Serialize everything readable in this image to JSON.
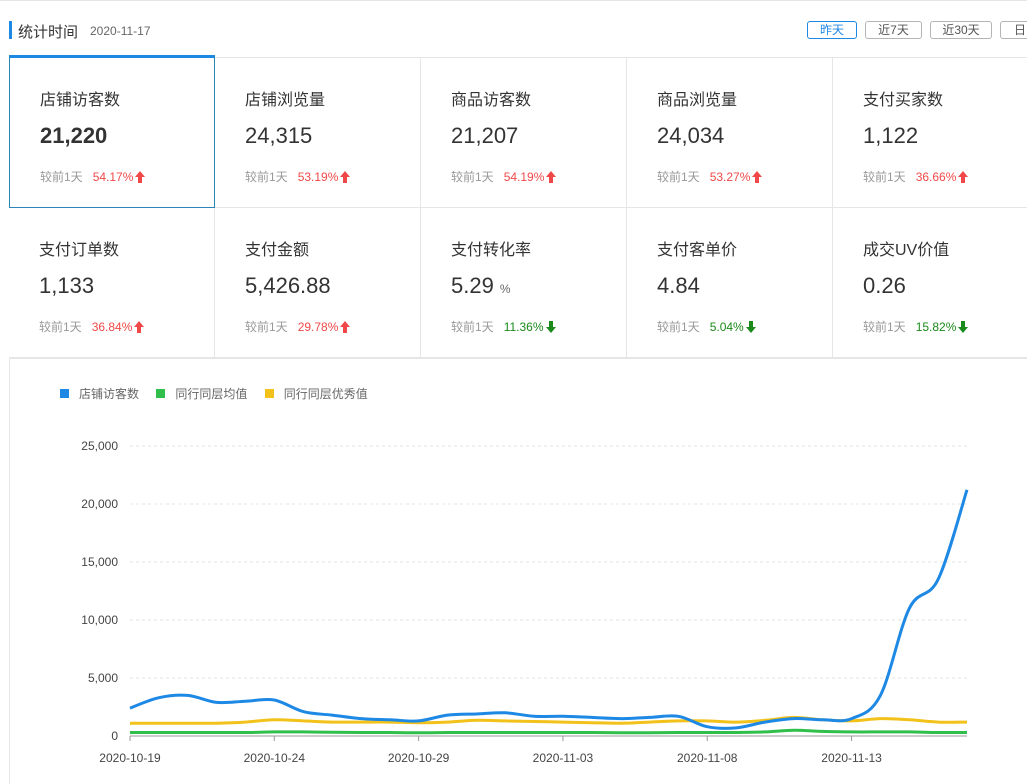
{
  "header": {
    "title": "统计时间",
    "date": "2020-11-17",
    "ranges": [
      "昨天",
      "近7天",
      "近30天",
      "日"
    ],
    "active_range": "昨天"
  },
  "colors": {
    "accent": "#1e88e5",
    "up": "#f04848",
    "down": "#1a8a1a",
    "series": [
      "#1e88e5",
      "#2fbf4a",
      "#f2c21b"
    ]
  },
  "metrics": [
    {
      "label": "店铺访客数",
      "value": "21,220",
      "compare": "较前1天",
      "pct": "54.17%",
      "dir": "up"
    },
    {
      "label": "店铺浏览量",
      "value": "24,315",
      "compare": "较前1天",
      "pct": "53.19%",
      "dir": "up"
    },
    {
      "label": "商品访客数",
      "value": "21,207",
      "compare": "较前1天",
      "pct": "54.19%",
      "dir": "up"
    },
    {
      "label": "商品浏览量",
      "value": "24,034",
      "compare": "较前1天",
      "pct": "53.27%",
      "dir": "up"
    },
    {
      "label": "支付买家数",
      "value": "1,122",
      "compare": "较前1天",
      "pct": "36.66%",
      "dir": "up"
    },
    {
      "label": "支付订单数",
      "value": "1,133",
      "compare": "较前1天",
      "pct": "36.84%",
      "dir": "up"
    },
    {
      "label": "支付金额",
      "value": "5,426.88",
      "compare": "较前1天",
      "pct": "29.78%",
      "dir": "up"
    },
    {
      "label": "支付转化率",
      "value": "5.29",
      "unit": "%",
      "compare": "较前1天",
      "pct": "11.36%",
      "dir": "down"
    },
    {
      "label": "支付客单价",
      "value": "4.84",
      "compare": "较前1天",
      "pct": "5.04%",
      "dir": "down"
    },
    {
      "label": "成交UV价值",
      "value": "0.26",
      "compare": "较前1天",
      "pct": "15.82%",
      "dir": "down"
    }
  ],
  "chart_data": {
    "type": "line",
    "title": "",
    "xlabel": "",
    "ylabel": "",
    "ylim": [
      0,
      25000
    ],
    "yticks": [
      0,
      5000,
      10000,
      15000,
      20000,
      25000
    ],
    "ytick_labels": [
      "0",
      "5,000",
      "10,000",
      "15,000",
      "20,000",
      "25,000"
    ],
    "xtick_labels": [
      "2020-10-19",
      "2020-10-24",
      "2020-10-29",
      "2020-11-03",
      "2020-11-08",
      "2020-11-13"
    ],
    "grid": true,
    "legend_position": "top-left",
    "x": [
      "2020-10-19",
      "2020-10-20",
      "2020-10-21",
      "2020-10-22",
      "2020-10-23",
      "2020-10-24",
      "2020-10-25",
      "2020-10-26",
      "2020-10-27",
      "2020-10-28",
      "2020-10-29",
      "2020-10-30",
      "2020-10-31",
      "2020-11-01",
      "2020-11-02",
      "2020-11-03",
      "2020-11-04",
      "2020-11-05",
      "2020-11-06",
      "2020-11-07",
      "2020-11-08",
      "2020-11-09",
      "2020-11-10",
      "2020-11-11",
      "2020-11-12",
      "2020-11-13",
      "2020-11-14",
      "2020-11-15",
      "2020-11-16",
      "2020-11-17"
    ],
    "series": [
      {
        "name": "店铺访客数",
        "values": [
          2400,
          3300,
          3500,
          2900,
          3000,
          3100,
          2100,
          1800,
          1500,
          1400,
          1300,
          1800,
          1900,
          2000,
          1700,
          1700,
          1600,
          1500,
          1600,
          1700,
          800,
          700,
          1200,
          1500,
          1400,
          1500,
          3500,
          11000,
          13500,
          21220
        ]
      },
      {
        "name": "同行同层均值",
        "values": [
          300,
          300,
          300,
          300,
          300,
          350,
          350,
          320,
          300,
          300,
          280,
          300,
          300,
          300,
          300,
          300,
          300,
          280,
          280,
          300,
          300,
          300,
          350,
          500,
          400,
          350,
          350,
          350,
          300,
          300
        ]
      },
      {
        "name": "同行同层优秀值",
        "values": [
          1100,
          1100,
          1100,
          1100,
          1200,
          1400,
          1300,
          1200,
          1200,
          1200,
          1150,
          1200,
          1350,
          1300,
          1250,
          1200,
          1150,
          1100,
          1200,
          1300,
          1300,
          1200,
          1350,
          1600,
          1400,
          1300,
          1500,
          1400,
          1200,
          1200
        ]
      }
    ]
  }
}
